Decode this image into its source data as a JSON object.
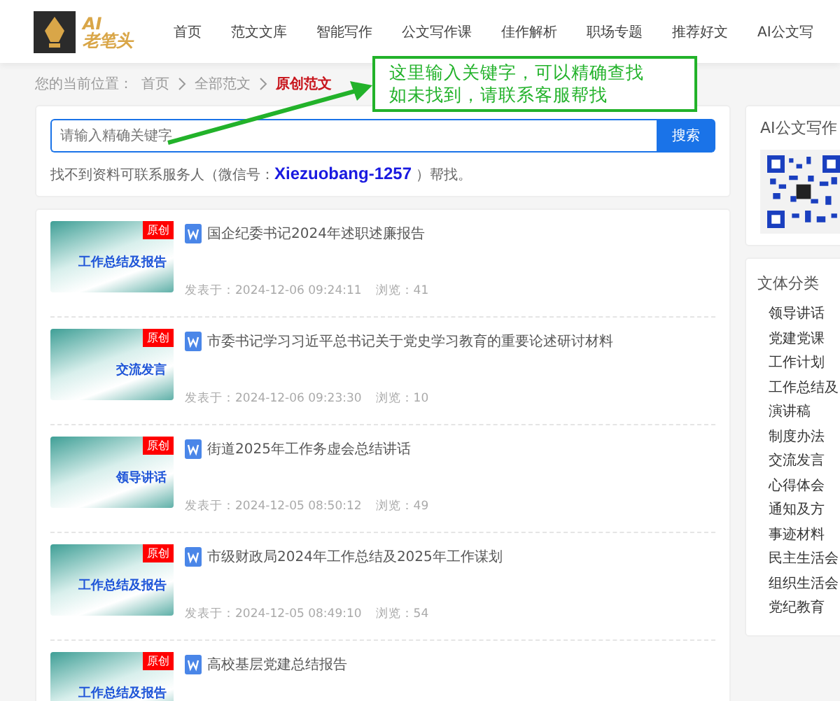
{
  "header": {
    "logo_text": "AI",
    "logo_name": "老笔头",
    "nav": [
      {
        "label": "首页",
        "selected": false
      },
      {
        "label": "范文文库",
        "selected": false
      },
      {
        "label": "智能写作",
        "selected": false
      },
      {
        "label": "公文写作课",
        "selected": false
      },
      {
        "label": "佳作解析",
        "selected": false
      },
      {
        "label": "职场专题",
        "selected": false
      },
      {
        "label": "推荐好文",
        "selected": false
      },
      {
        "label": "AI公文写",
        "selected": false
      }
    ]
  },
  "breadcrumb": {
    "prefix": "您的当前位置：",
    "items": [
      "首页",
      "全部范文"
    ],
    "current": "原创范文"
  },
  "callout": {
    "lines": [
      "这里输入关键字，可以精确查找",
      "如未找到，请联系客服帮找"
    ]
  },
  "search": {
    "placeholder": "请输入精确关键字",
    "button": "搜索",
    "hint": "找不到资料可联系服务人（微信号：**Xiezuobang-1257** ）帮找。"
  },
  "articles": [
    {
      "thumb_label": "工作总结及报告",
      "badge": "原创",
      "title": "国企纪委书记2024年述职述廉报告",
      "date": "发表于：2024-12-06 09:24:11",
      "views": "浏览：41"
    },
    {
      "thumb_label": "交流发言",
      "badge": "原创",
      "title": "市委书记学习习近平总书记关于党史学习教育的重要论述研讨材料",
      "date": "发表于：2024-12-06 09:23:30",
      "views": "浏览：10"
    },
    {
      "thumb_label": "领导讲话",
      "badge": "原创",
      "title": "街道2025年工作务虚会总结讲话",
      "date": "发表于：2024-12-05 08:50:12",
      "views": "浏览：49"
    },
    {
      "thumb_label": "工作总结及报告",
      "badge": "原创",
      "title": "市级财政局2024年工作总结及2025年工作谋划",
      "date": "发表于：2024-12-05 08:49:10",
      "views": "浏览：54"
    },
    {
      "thumb_label": "工作总结及报告",
      "badge": "原创",
      "title": "高校基层党建总结报告"
    }
  ],
  "sidebar": {
    "qr_title": "AI公文写作",
    "category_title": "文体分类",
    "categories": [
      "领导讲话",
      "党建党课",
      "工作计划",
      "工作总结及",
      "演讲稿",
      "制度办法",
      "交流发言",
      "心得体会",
      "通知及方",
      "事迹材料",
      "民主生活会",
      "组织生活会",
      "党纪教育"
    ]
  }
}
